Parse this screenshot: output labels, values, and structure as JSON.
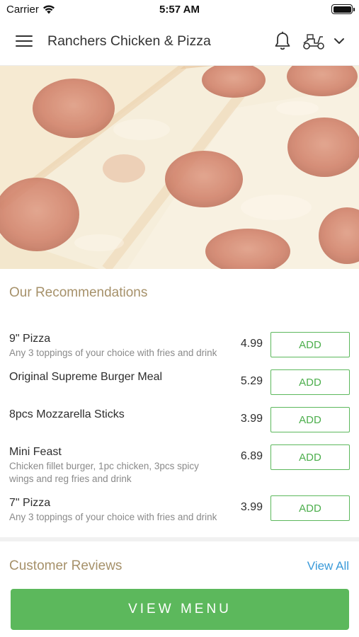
{
  "status_bar": {
    "carrier": "Carrier",
    "time": "5:57 AM"
  },
  "header": {
    "title": "Ranchers Chicken & Pizza"
  },
  "icons": {
    "menu": "hamburger-icon",
    "notifications": "bell-icon",
    "delivery_mode": "scooter-icon",
    "dropdown": "chevron-down-icon",
    "wifi": "wifi-icon",
    "battery": "battery-icon"
  },
  "hero": {
    "image": "pepperoni pizza photo"
  },
  "recommendations": {
    "title": "Our Recommendations",
    "items": [
      {
        "name": "9\" Pizza",
        "description": "Any 3 toppings of your choice with fries and drink",
        "price": "4.99",
        "add_label": "ADD"
      },
      {
        "name": "Original Supreme Burger Meal",
        "description": "",
        "price": "5.29",
        "add_label": "ADD"
      },
      {
        "name": "8pcs Mozzarella Sticks",
        "description": "",
        "price": "3.99",
        "add_label": "ADD"
      },
      {
        "name": "Mini Feast",
        "description": "Chicken fillet burger, 1pc chicken, 3pcs spicy wings and reg fries and drink",
        "price": "6.89",
        "add_label": "ADD"
      },
      {
        "name": "7\" Pizza",
        "description": "Any 3 toppings of your choice with fries and drink",
        "price": "3.99",
        "add_label": "ADD"
      }
    ]
  },
  "reviews": {
    "title": "Customer Reviews",
    "view_all_label": "View All"
  },
  "footer": {
    "view_menu_label": "VIEW MENU"
  },
  "colors": {
    "accent_green": "#5cb85c",
    "section_title": "#a6916a",
    "link_blue": "#3a9ad9"
  }
}
